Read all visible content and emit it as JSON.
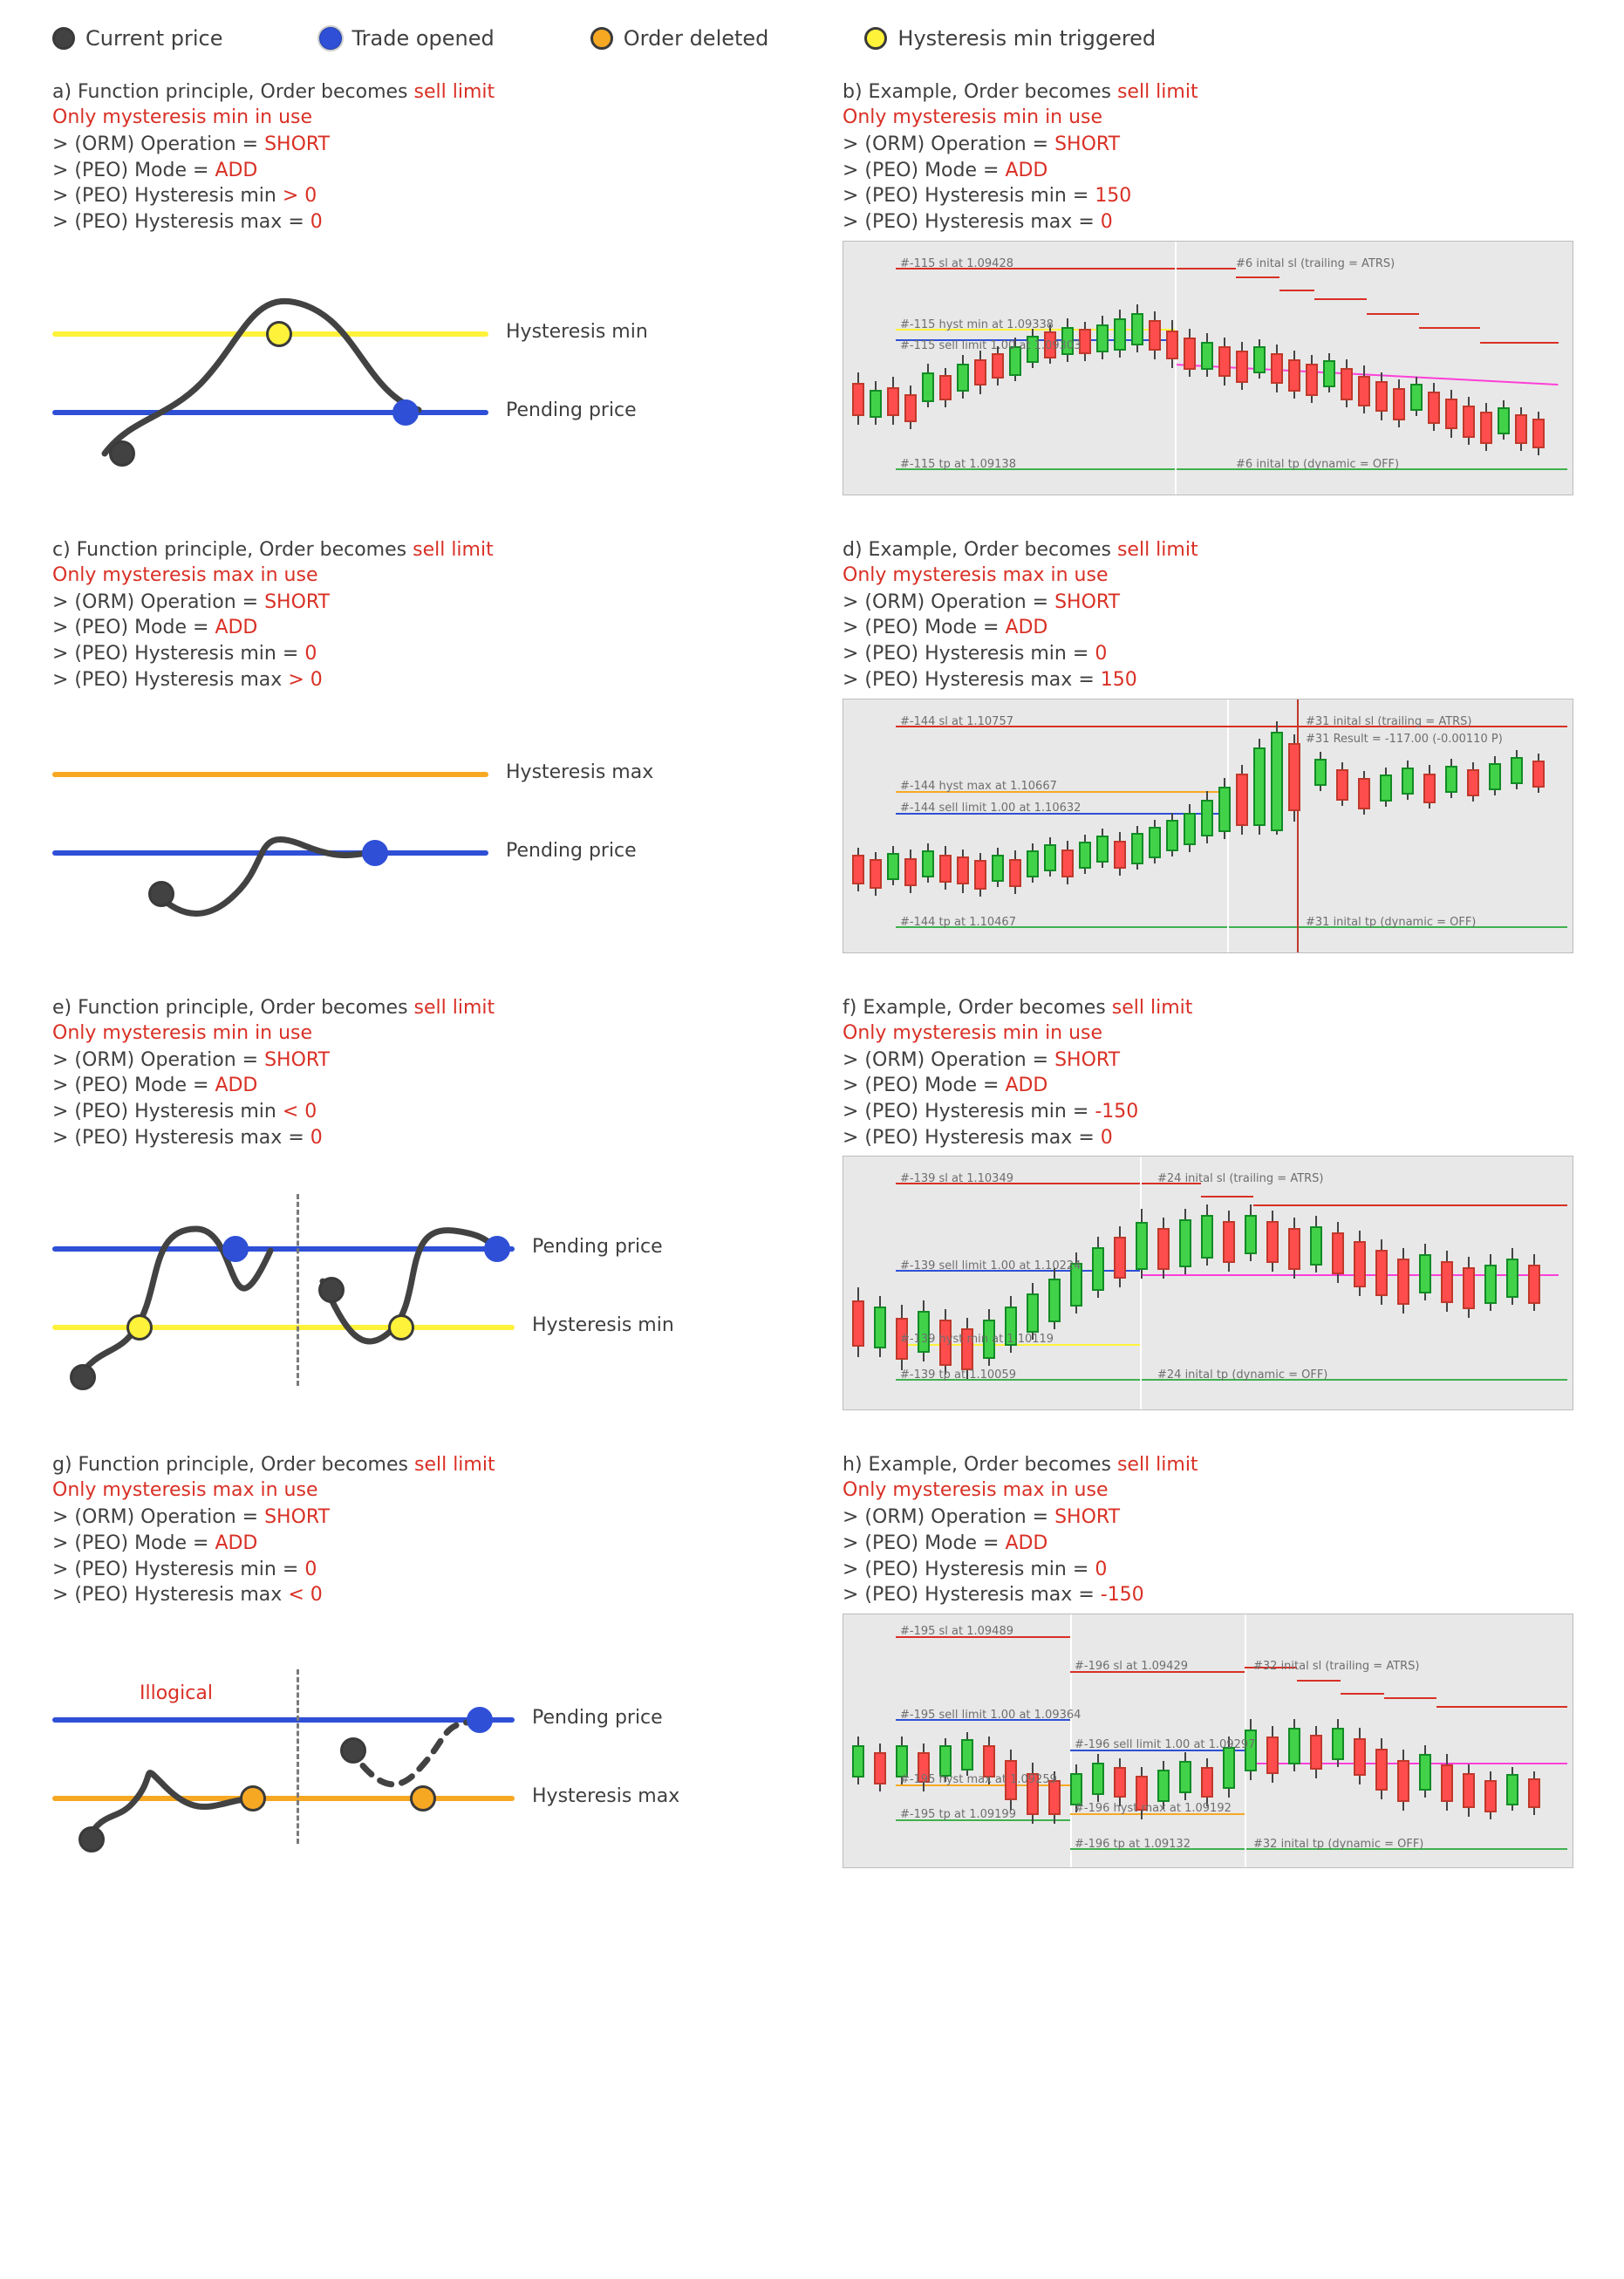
{
  "legend": {
    "current": "Current price",
    "trade": "Trade opened",
    "deleted": "Order deleted",
    "hmin": "Hysteresis min triggered"
  },
  "common": {
    "orm": "> (ORM) Operation = ",
    "orm_val": "SHORT",
    "mode": "> (PEO) Mode = ",
    "mode_val": "ADD",
    "hmin": "> (PEO) Hysteresis min ",
    "hmax": "> (PEO) Hysteresis max ",
    "eq": "= ",
    "lbl_hmin": "Hysteresis min",
    "lbl_hmax": "Hysteresis max",
    "lbl_pp": "Pending price"
  },
  "a": {
    "title": "a) Function principle, Order becomes ",
    "kind": "sell limit",
    "sub": "Only mysteresis min in use",
    "hmin_rel": "> 0",
    "hmax_val": "0"
  },
  "b": {
    "title": "b) Example, Order becomes ",
    "kind": "sell limit",
    "sub": "Only mysteresis min in use",
    "hmin_val": "150",
    "hmax_val": "0",
    "labels": {
      "sl": "#-115 sl at 1.09428",
      "hyst": "#-115 hyst min at 1.09338",
      "sell": "#-115 sell limit 1.00 at 1.09303",
      "tp": "#-115 tp at 1.09138",
      "r1": "#6 inital sl (trailing = ATRS)",
      "r2": "#6 inital tp (dynamic = OFF)"
    }
  },
  "c": {
    "title": "c) Function principle, Order becomes ",
    "kind": "sell limit",
    "sub": "Only mysteresis max in use",
    "hmin_val": "0",
    "hmax_rel": "> 0"
  },
  "d": {
    "title": "d) Example, Order becomes ",
    "kind": "sell limit",
    "sub": "Only mysteresis max in use",
    "hmin_val": "0",
    "hmax_val": "150",
    "labels": {
      "sl": "#-144 sl at 1.10757",
      "hyst": "#-144 hyst max at 1.10667",
      "sell": "#-144 sell limit 1.00 at 1.10632",
      "tp": "#-144 tp at 1.10467",
      "r1": "#31 inital sl (trailing = ATRS)",
      "r2": "#31 inital tp (dynamic = OFF)",
      "res": "#31 Result = -117.00 (-0.00110 P)"
    }
  },
  "e": {
    "title": "e) Function principle, Order becomes ",
    "kind": "sell limit",
    "sub": "Only mysteresis min in use",
    "hmin_rel": "< 0",
    "hmax_val": "0"
  },
  "f": {
    "title": "f) Example, Order becomes ",
    "kind": "sell limit",
    "sub": "Only mysteresis min in use",
    "hmin_val": "-150",
    "hmax_val": "0",
    "labels": {
      "sl": "#-139 sl at 1.10349",
      "sell": "#-139 sell limit 1.00 at 1.10224",
      "hyst": "#-139 hyst min at 1.10119",
      "tp": "#-139 tp at 1.10059",
      "r1": "#24 inital sl (trailing = ATRS)",
      "r2": "#24 inital tp (dynamic = OFF)"
    }
  },
  "g": {
    "title": "g) Function principle, Order becomes ",
    "kind": "sell limit",
    "sub": "Only mysteresis max in use",
    "hmin_val": "0",
    "hmax_rel": "< 0",
    "illog": "Illogical"
  },
  "h": {
    "title": "h) Example, Order becomes ",
    "kind": "sell limit",
    "sub": "Only mysteresis max in use",
    "hmin_val": "0",
    "hmax_val": "-150",
    "labels": {
      "sl": "#-195 sl at 1.09489",
      "sell": "#-195 sell limit 1.00 at 1.09364",
      "hyst": "#-195 hyst max at 1.09259",
      "tp": "#-195 tp at 1.09199",
      "sl2": "#-196 sl at 1.09429",
      "sell2": "#-196 sell limit 1.00 at 1.09297",
      "hyst2": "#-196 hyst max at 1.09192",
      "tp2": "#-196 tp at 1.09132",
      "r1": "#32 inital sl (trailing = ATRS)",
      "r2": "#32 inital tp (dynamic = OFF)"
    }
  }
}
